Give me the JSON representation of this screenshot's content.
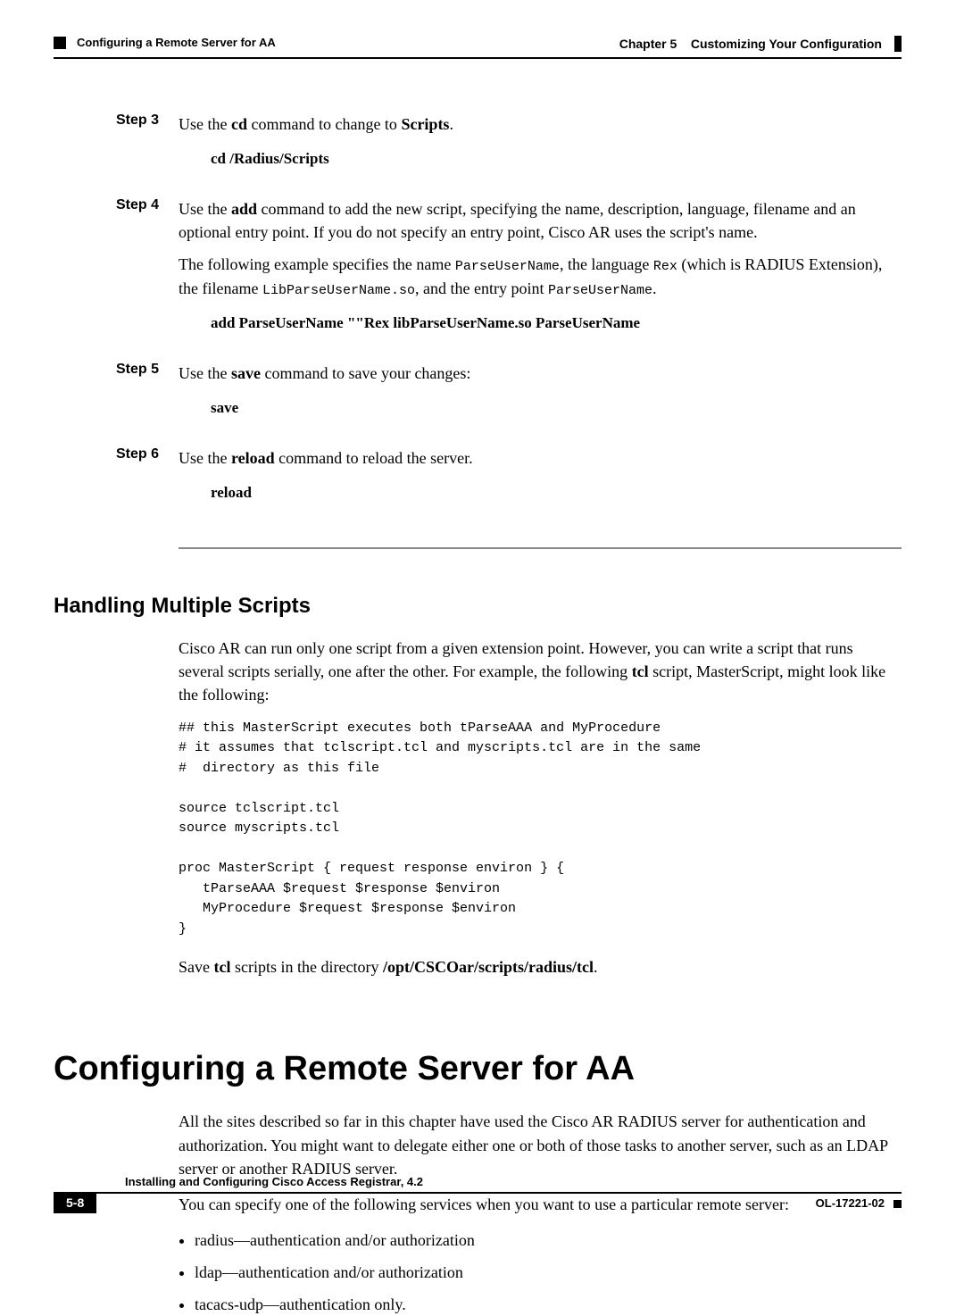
{
  "header": {
    "chapter_label": "Chapter 5",
    "chapter_title": "Customizing Your Configuration",
    "section_title": "Configuring a Remote Server for AA"
  },
  "steps": {
    "s3": {
      "label": "Step 3",
      "text_pre": "Use the ",
      "cmd1": "cd",
      "text_mid": " command to change to ",
      "cmd2": "Scripts",
      "text_post": ".",
      "cmd_line": "cd /Radius/Scripts"
    },
    "s4": {
      "label": "Step 4",
      "p1a": "Use the ",
      "p1b": "add",
      "p1c": " command to add the new script, specifying the name, description, language, filename and an optional entry point. If you do not specify an entry point, Cisco AR uses the script's name.",
      "p2a": "The following example specifies the name ",
      "p2b": "ParseUserName",
      "p2c": ", the language ",
      "p2d": "Rex",
      "p2e": " (which is RADIUS Extension), the filename ",
      "p2f": "LibParseUserName.so",
      "p2g": ", and the entry point ",
      "p2h": "ParseUserName",
      "p2i": ".",
      "cmd_line": "add ParseUserName \"\"Rex libParseUserName.so ParseUserName"
    },
    "s5": {
      "label": "Step 5",
      "text_pre": "Use the ",
      "cmd1": "save",
      "text_post": " command to save your changes:",
      "cmd_line": "save"
    },
    "s6": {
      "label": "Step 6",
      "text_pre": "Use the ",
      "cmd1": "reload",
      "text_post": " command to reload the server.",
      "cmd_line": "reload"
    }
  },
  "multiscripts": {
    "heading": "Handling Multiple Scripts",
    "p1a": "Cisco AR can run only one script from a given extension point. However, you can write a script that runs several scripts serially, one after the other. For example, the following ",
    "p1b": "tcl",
    "p1c": " script, MasterScript, might look like the following:",
    "code": "## this MasterScript executes both tParseAAA and MyProcedure\n# it assumes that tclscript.tcl and myscripts.tcl are in the same\n#  directory as this file\n\nsource tclscript.tcl\nsource myscripts.tcl\n\nproc MasterScript { request response environ } {\n   tParseAAA $request $response $environ\n   MyProcedure $request $response $environ\n}",
    "p2a": "Save ",
    "p2b": "tcl",
    "p2c": " scripts in the directory ",
    "p2d": "/opt/CSCOar/scripts/radius/tcl",
    "p2e": "."
  },
  "remote": {
    "heading": "Configuring a Remote Server for AA",
    "p1": "All the sites described so far in this chapter have used the Cisco AR RADIUS server for authentication and authorization. You might want to delegate either one or both of those tasks to another server, such as an LDAP server or another RADIUS server.",
    "p2": "You can specify one of the following services when you want to use a particular remote server:",
    "bullets": [
      "radius—authentication and/or authorization",
      "ldap—authentication and/or authorization",
      "tacacs-udp—authentication only."
    ]
  },
  "footer": {
    "book_title": "Installing and Configuring Cisco Access Registrar, 4.2",
    "page_num": "5-8",
    "doc_id": "OL-17221-02"
  }
}
